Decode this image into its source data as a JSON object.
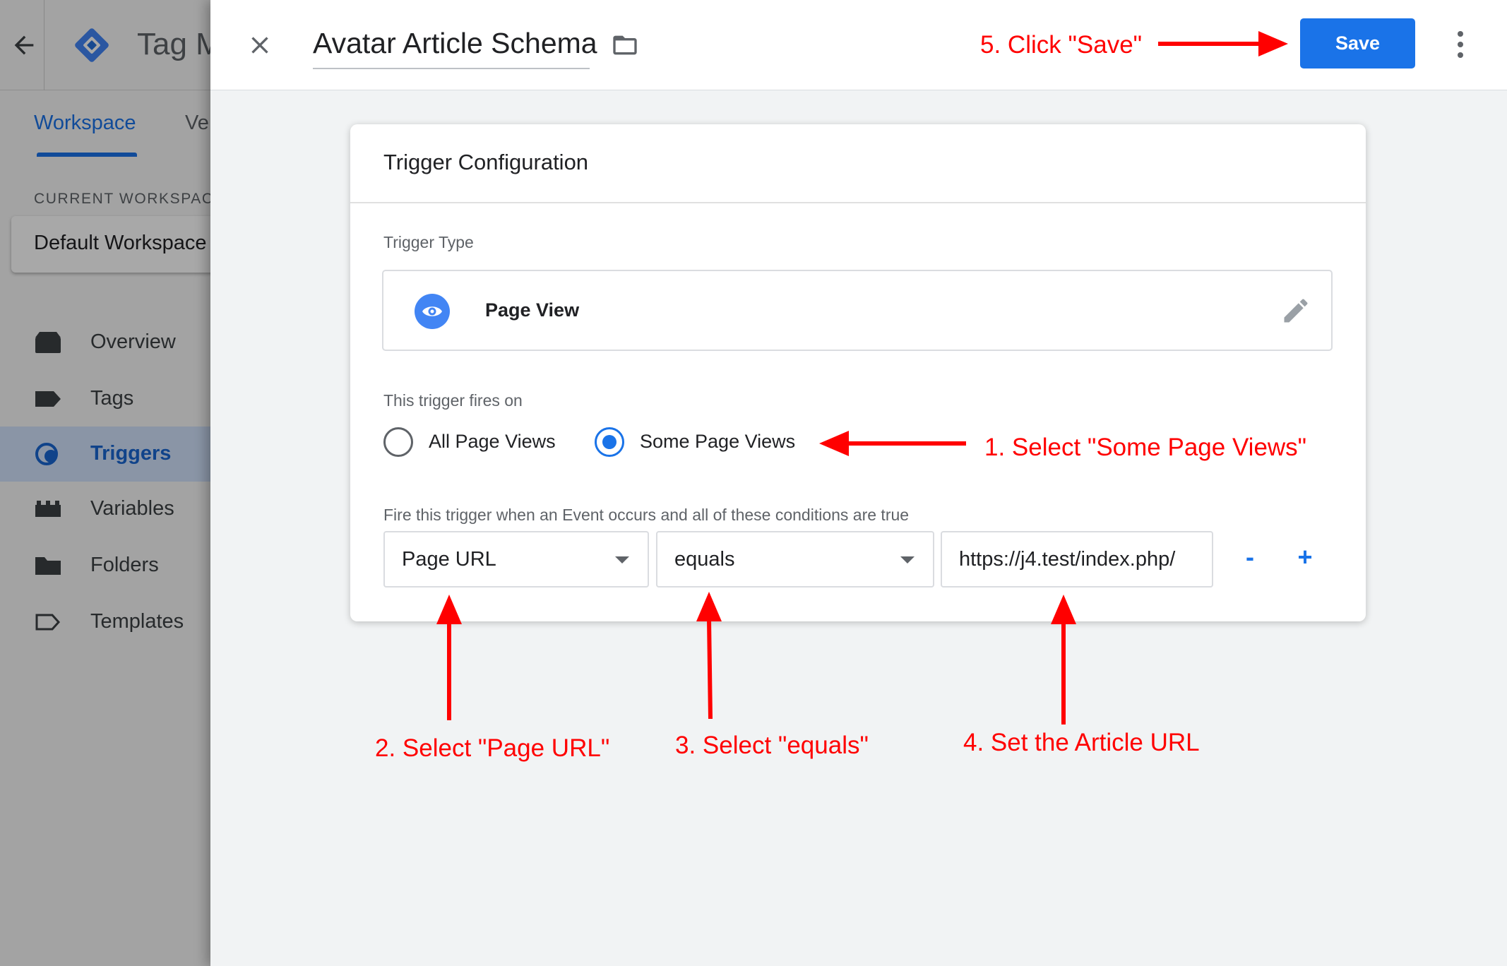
{
  "background_app": {
    "title": "Tag M",
    "tabs": [
      {
        "label": "Workspace",
        "active": true
      },
      {
        "label": "Ve",
        "active": false
      }
    ],
    "current_workspace_label": "CURRENT WORKSPACE",
    "workspace_name": "Default Workspace",
    "nav_items": [
      {
        "label": "Overview",
        "icon": "overview-icon",
        "active": false
      },
      {
        "label": "Tags",
        "icon": "tag-icon",
        "active": false
      },
      {
        "label": "Triggers",
        "icon": "trigger-icon",
        "active": true
      },
      {
        "label": "Variables",
        "icon": "variables-icon",
        "active": false
      },
      {
        "label": "Folders",
        "icon": "folder-icon",
        "active": false
      },
      {
        "label": "Templates",
        "icon": "template-icon",
        "active": false
      }
    ]
  },
  "editor": {
    "name": "Avatar Article Schema",
    "save_label": "Save",
    "card": {
      "title": "Trigger Configuration",
      "trigger_type_label": "Trigger Type",
      "trigger_type": "Page View",
      "fires_on_label": "This trigger fires on",
      "options": [
        {
          "label": "All Page Views",
          "selected": false
        },
        {
          "label": "Some Page Views",
          "selected": true
        }
      ],
      "condition_label": "Fire this trigger when an Event occurs and all of these conditions are true",
      "condition": {
        "variable": "Page URL",
        "operator": "equals",
        "value": "https://j4.test/index.php/"
      },
      "remove_label": "-",
      "add_label": "+"
    }
  },
  "annotations": {
    "step1": "1. Select \"Some Page Views\"",
    "step2": "2. Select \"Page URL\"",
    "step3": "3. Select \"equals\"",
    "step4": "4. Set the Article URL",
    "step5": "5. Click \"Save\""
  },
  "colors": {
    "accent": "#1a73e8",
    "annotation": "#ff0000",
    "active_nav_bg": "#d2e3fc"
  }
}
